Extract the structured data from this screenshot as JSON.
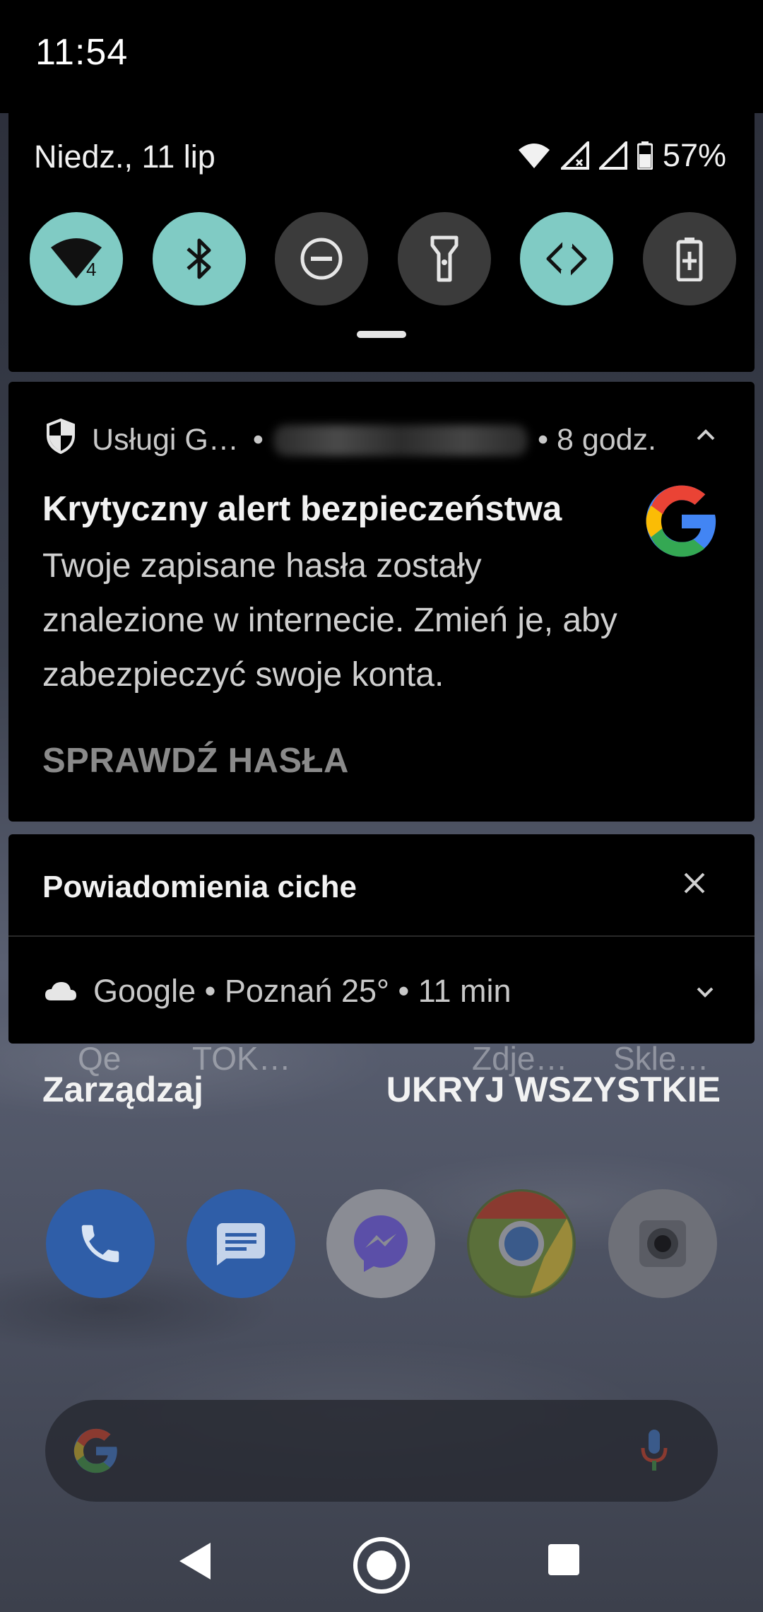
{
  "status_bar": {
    "time": "11:54"
  },
  "quick_settings": {
    "date": "Niedz., 11 lip",
    "battery_percent": "57%",
    "wifi_badge": "4",
    "tiles": [
      {
        "name": "wifi",
        "active": true
      },
      {
        "name": "bluetooth",
        "active": true
      },
      {
        "name": "do-not-disturb",
        "active": false
      },
      {
        "name": "flashlight",
        "active": false
      },
      {
        "name": "auto-rotate",
        "active": true
      },
      {
        "name": "battery-saver",
        "active": false
      }
    ],
    "colors": {
      "active_tile": "#80cbc4",
      "inactive_tile": "#3b3b3b"
    }
  },
  "notification": {
    "app_name": "Usługi G…",
    "time": "• 8 godz.",
    "title": "Krytyczny alert bezpieczeństwa",
    "body": "Twoje zapisane hasła zostały znalezione w internecie. Zmień je, aby zabezpieczyć swoje konta.",
    "action": "SPRAWDŹ HASŁA"
  },
  "silent_section": {
    "title": "Powiadomienia ciche",
    "weather_row": "Google • Poznań 25° • 11 min"
  },
  "background_labels": [
    "Qe",
    "TOK…",
    "Zdje…",
    "Skle…"
  ],
  "footer": {
    "manage": "Zarządzaj",
    "hide_all": "UKRYJ WSZYSTKIE"
  }
}
